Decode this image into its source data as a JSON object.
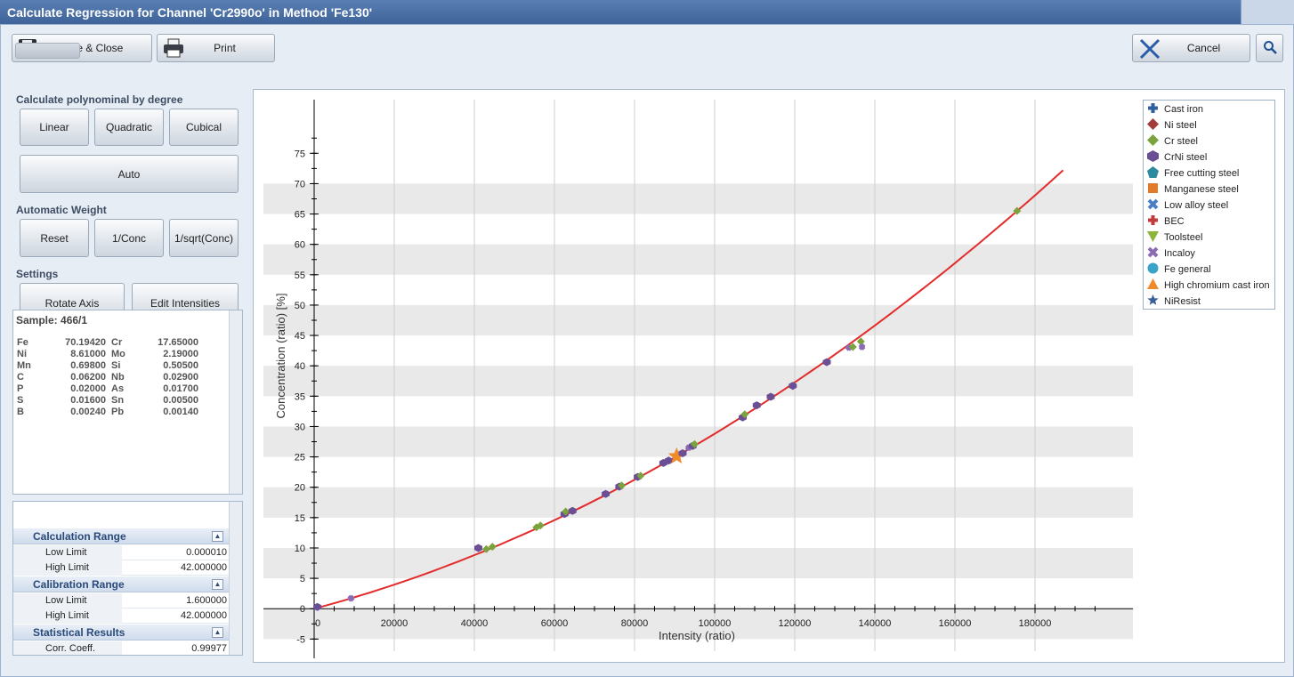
{
  "window": {
    "title": "Calculate Regression for Channel 'Cr2990o' in Method 'Fe130'"
  },
  "toolbar": {
    "save_close": "Save & Close",
    "print": "Print",
    "cancel": "Cancel"
  },
  "polynomial": {
    "heading": "Calculate polynominal by degree",
    "linear": "Linear",
    "quadratic": "Quadratic",
    "cubical": "Cubical",
    "auto": "Auto"
  },
  "weight": {
    "heading": "Automatic Weight",
    "reset": "Reset",
    "conc": "1/Conc",
    "sqrt": "1/sqrt(Conc)"
  },
  "settings": {
    "heading": "Settings",
    "rotate": "Rotate Axis",
    "edit": "Edit Intensities"
  },
  "sample": {
    "title": "Sample: 466/1",
    "rows": [
      [
        "Fe",
        "70.19420",
        "Cr",
        "17.65000"
      ],
      [
        "Ni",
        "8.61000",
        "Mo",
        "2.19000"
      ],
      [
        "Mn",
        "0.69800",
        "Si",
        "0.50500"
      ],
      [
        "C",
        "0.06200",
        "Nb",
        "0.02900"
      ],
      [
        "P",
        "0.02000",
        "As",
        "0.01700"
      ],
      [
        "S",
        "0.01600",
        "Sn",
        "0.00500"
      ],
      [
        "B",
        "0.00240",
        "Pb",
        "0.00140"
      ]
    ]
  },
  "properties": {
    "calc_range": {
      "title": "Calculation Range",
      "low_label": "Low Limit",
      "low": "0.000010",
      "high_label": "High Limit",
      "high": "42.000000"
    },
    "calib_range": {
      "title": "Calibration Range",
      "low_label": "Low Limit",
      "low": "1.600000",
      "high_label": "High Limit",
      "high": "42.000000"
    },
    "stats": {
      "title": "Statistical Results",
      "corr_label": "Corr. Coeff.",
      "corr": "0.99977"
    }
  },
  "legend": [
    {
      "label": "Cast iron",
      "color": "#2f5f9e",
      "shape": "plus"
    },
    {
      "label": "Ni steel",
      "color": "#a33b3b",
      "shape": "diamond"
    },
    {
      "label": "Cr steel",
      "color": "#7aa33d",
      "shape": "diamond"
    },
    {
      "label": "CrNi steel",
      "color": "#6a4f95",
      "shape": "hexagon"
    },
    {
      "label": "Free cutting steel",
      "color": "#2b8a9e",
      "shape": "pentagon"
    },
    {
      "label": "Manganese steel",
      "color": "#e07b2b",
      "shape": "square"
    },
    {
      "label": "Low alloy steel",
      "color": "#4b7fc4",
      "shape": "x"
    },
    {
      "label": "BEC",
      "color": "#c23a3a",
      "shape": "plus"
    },
    {
      "label": "Toolsteel",
      "color": "#8db53c",
      "shape": "triangle-down"
    },
    {
      "label": "Incaloy",
      "color": "#8b6bb3",
      "shape": "x"
    },
    {
      "label": "Fe general",
      "color": "#3aa3c8",
      "shape": "circle"
    },
    {
      "label": "High chromium cast iron",
      "color": "#f08a2a",
      "shape": "triangle"
    },
    {
      "label": "NiResist",
      "color": "#3c5f9a",
      "shape": "star"
    }
  ],
  "chart_data": {
    "type": "scatter",
    "xlabel": "Intensity (ratio)",
    "ylabel": "Concentration (ratio) [%]",
    "xlim": [
      0,
      200000
    ],
    "ylim": [
      -7,
      79
    ],
    "xticks": [
      0,
      20000,
      40000,
      60000,
      80000,
      100000,
      120000,
      140000,
      160000,
      180000
    ],
    "yticks": [
      -5,
      0,
      5,
      10,
      15,
      20,
      25,
      30,
      35,
      40,
      45,
      50,
      55,
      60,
      65,
      70,
      75
    ],
    "grid": true,
    "curve": {
      "color": "#e32b2b",
      "x_end": 187000,
      "y_end": 72.2
    },
    "points": [
      {
        "x": 800,
        "y": 0.3,
        "s": "CrNi steel"
      },
      {
        "x": 9200,
        "y": 1.7,
        "s": "Incaloy"
      },
      {
        "x": 41000,
        "y": 10.0,
        "s": "CrNi steel"
      },
      {
        "x": 43000,
        "y": 9.8,
        "s": "Cr steel"
      },
      {
        "x": 44500,
        "y": 10.2,
        "s": "Cr steel"
      },
      {
        "x": 55500,
        "y": 13.4,
        "s": "Cr steel"
      },
      {
        "x": 56500,
        "y": 13.7,
        "s": "Cr steel"
      },
      {
        "x": 62500,
        "y": 15.6,
        "s": "CrNi steel"
      },
      {
        "x": 62800,
        "y": 16.0,
        "s": "Cr steel"
      },
      {
        "x": 64500,
        "y": 16.1,
        "s": "CrNi steel"
      },
      {
        "x": 72800,
        "y": 18.9,
        "s": "CrNi steel"
      },
      {
        "x": 76200,
        "y": 20.1,
        "s": "CrNi steel"
      },
      {
        "x": 76800,
        "y": 20.3,
        "s": "Cr steel"
      },
      {
        "x": 80800,
        "y": 21.7,
        "s": "CrNi steel"
      },
      {
        "x": 81500,
        "y": 21.9,
        "s": "Cr steel"
      },
      {
        "x": 87200,
        "y": 24.0,
        "s": "CrNi steel"
      },
      {
        "x": 88500,
        "y": 24.4,
        "s": "CrNi steel"
      },
      {
        "x": 90500,
        "y": 25.1,
        "s": "High chromium cast iron"
      },
      {
        "x": 92000,
        "y": 25.6,
        "s": "CrNi steel"
      },
      {
        "x": 93500,
        "y": 26.5,
        "s": "Incaloy"
      },
      {
        "x": 94500,
        "y": 26.8,
        "s": "CrNi steel"
      },
      {
        "x": 95000,
        "y": 27.1,
        "s": "Cr steel"
      },
      {
        "x": 107000,
        "y": 31.5,
        "s": "CrNi steel"
      },
      {
        "x": 107500,
        "y": 32.0,
        "s": "Cr steel"
      },
      {
        "x": 110500,
        "y": 33.5,
        "s": "CrNi steel"
      },
      {
        "x": 114000,
        "y": 34.9,
        "s": "CrNi steel"
      },
      {
        "x": 119500,
        "y": 36.7,
        "s": "CrNi steel"
      },
      {
        "x": 128000,
        "y": 40.6,
        "s": "CrNi steel"
      },
      {
        "x": 133500,
        "y": 43.0,
        "s": "Incaloy"
      },
      {
        "x": 134500,
        "y": 43.1,
        "s": "Cr steel"
      },
      {
        "x": 136500,
        "y": 44.0,
        "s": "Cr steel"
      },
      {
        "x": 136800,
        "y": 43.1,
        "s": "Incaloy"
      },
      {
        "x": 175500,
        "y": 65.5,
        "s": "Cr steel"
      }
    ]
  }
}
